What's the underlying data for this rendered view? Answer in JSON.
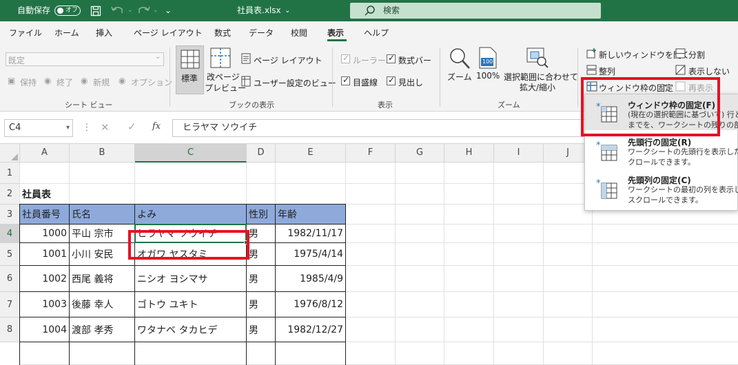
{
  "titlebar": {
    "autosave_label": "自動保存",
    "autosave_state": "オフ",
    "filename": "社員表.xlsx",
    "filename_chevron": "⌄",
    "search_placeholder": "検索"
  },
  "tabs": [
    {
      "label": "ファイル"
    },
    {
      "label": "ホーム"
    },
    {
      "label": "挿入"
    },
    {
      "label": "ページ レイアウト"
    },
    {
      "label": "数式"
    },
    {
      "label": "データ"
    },
    {
      "label": "校閲"
    },
    {
      "label": "表示"
    },
    {
      "label": "ヘルプ"
    }
  ],
  "ribbon": {
    "sheetview": {
      "select_value": "既定",
      "keep": "保持",
      "exit": "終了",
      "new": "新規",
      "options": "オプション",
      "group": "シート ビュー"
    },
    "bookview": {
      "normal": "標準",
      "pagebreak_1": "改ページ",
      "pagebreak_2": "プレビュー",
      "page_layout": "ページ レイアウト",
      "custom_views": "ユーザー設定のビュー",
      "group": "ブックの表示"
    },
    "show": {
      "ruler": "ルーラー",
      "formula_bar": "数式バー",
      "gridlines": "目盛線",
      "headings": "見出し",
      "group": "表示"
    },
    "zoom": {
      "zoom": "ズーム",
      "hundred": "100%",
      "hundred_icon": "100",
      "fit_1": "選択範囲に合わせて",
      "fit_2": "拡大/縮小",
      "group": "ズーム"
    },
    "window": {
      "new_window": "新しいウィンドウを開く",
      "arrange": "整列",
      "freeze": "ウィンドウ枠の固定",
      "freeze_chevron": "⌄",
      "split": "分割",
      "hide": "表示しない",
      "unhide": "再表示"
    }
  },
  "formula_bar": {
    "name_box": "C4",
    "fx": "fx",
    "content": "ヒラヤマ ソウイチ"
  },
  "grid": {
    "columns": [
      "A",
      "B",
      "C",
      "D",
      "E",
      "F",
      "G",
      "H",
      "I",
      "J"
    ],
    "rows": [
      "1",
      "2",
      "3",
      "4",
      "5",
      "6",
      "7",
      "8"
    ],
    "title": "社員表",
    "headers": [
      "社員番号",
      "氏名",
      "よみ",
      "性別",
      "年齢"
    ],
    "data": [
      [
        "1000",
        "平山 宗市",
        "ヒラヤマ ソウイチ",
        "男",
        "1982/11/17"
      ],
      [
        "1001",
        "小川 安民",
        "オガワ ヤスタミ",
        "男",
        "1975/4/14"
      ],
      [
        "1002",
        "西尾 義将",
        "ニシオ ヨシマサ",
        "男",
        "1985/4/9"
      ],
      [
        "1003",
        "後藤 幸人",
        "ゴトウ ユキト",
        "男",
        "1976/8/12"
      ],
      [
        "1004",
        "渡部 孝秀",
        "ワタナベ タカヒデ",
        "男",
        "1982/12/27"
      ]
    ]
  },
  "dropdown": {
    "freeze_panes": {
      "title": "ウィンドウ枠の固定(F)",
      "desc1": "(現在の選択範囲に基づいて) 行と",
      "desc2": "までを、ワークシートの残りの部分を"
    },
    "freeze_top_row": {
      "title": "先頭行の固定(R)",
      "desc1": "ワークシートの先頭行を表示したま",
      "desc2": "クロールできます。"
    },
    "freeze_first_col": {
      "title": "先頭列の固定(C)",
      "desc1": "ワークシートの最初の列を表示した",
      "desc2": "スクロールできます。"
    }
  },
  "colors": {
    "excel_green": "#217346",
    "header_fill": "#8eaadb",
    "highlight_red": "#e81123",
    "freeze_icon_blue": "#2e75b6"
  }
}
